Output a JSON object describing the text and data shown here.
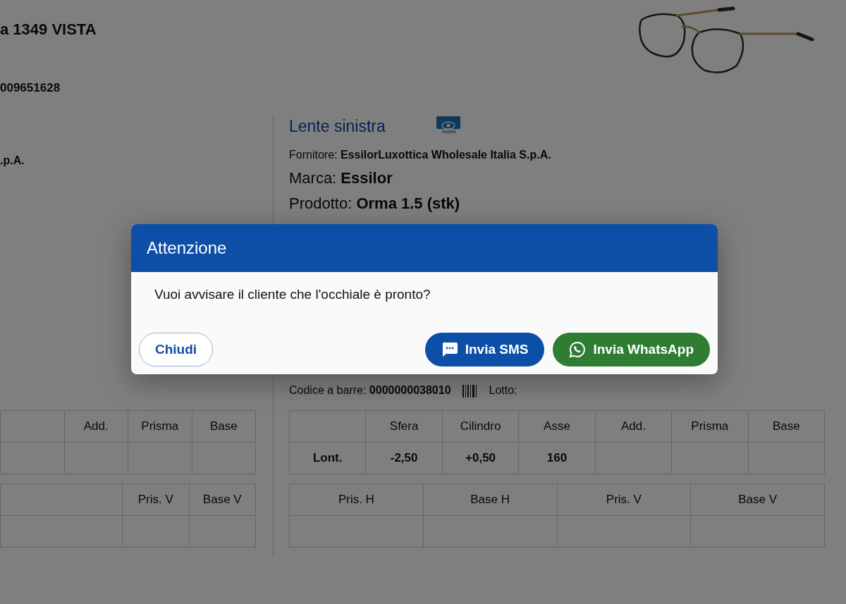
{
  "frame_title": "a 1349 VISTA",
  "frame_code": "009651628",
  "left_lens": {
    "supplier_fragment": ".p.A.",
    "table": {
      "columns": [
        "Add.",
        "Prisma",
        "Base"
      ]
    },
    "table_2": {
      "columns": [
        "Pris. V",
        "Base V"
      ]
    }
  },
  "right_lens": {
    "title": "Lente sinistra",
    "logo_text": "essilor",
    "fields": [
      {
        "label": "Fornitore:",
        "value": "EssilorLuxottica Wholesale Italia S.p.A.",
        "kind": "small"
      },
      {
        "label": "Marca:",
        "value": "Essilor",
        "kind": "large"
      },
      {
        "label": "Prodotto:",
        "value": "Orma 1.5 (stk)",
        "kind": "large"
      }
    ],
    "barcode": {
      "label": "Codice a barre:",
      "value": "0000000038010"
    },
    "lot_label": "Lotto:",
    "table": {
      "columns": [
        "Sfera",
        "Cilindro",
        "Asse",
        "Add.",
        "Prisma",
        "Base"
      ],
      "rows": [
        {
          "label": "Lont.",
          "values": [
            "-2,50",
            "+0,50",
            "160"
          ]
        }
      ]
    },
    "table_2": {
      "columns": [
        "Pris. H",
        "Base H",
        "Pris. V",
        "Base V"
      ]
    }
  },
  "modal": {
    "title": "Attenzione",
    "message": "Vuoi avvisare il cliente che l'occhiale è pronto?",
    "buttons": [
      {
        "label": "Chiudi",
        "kind": "close"
      },
      {
        "label": "Invia SMS",
        "kind": "sms"
      },
      {
        "label": "Invia WhatsApp",
        "kind": "whatsapp"
      }
    ]
  }
}
